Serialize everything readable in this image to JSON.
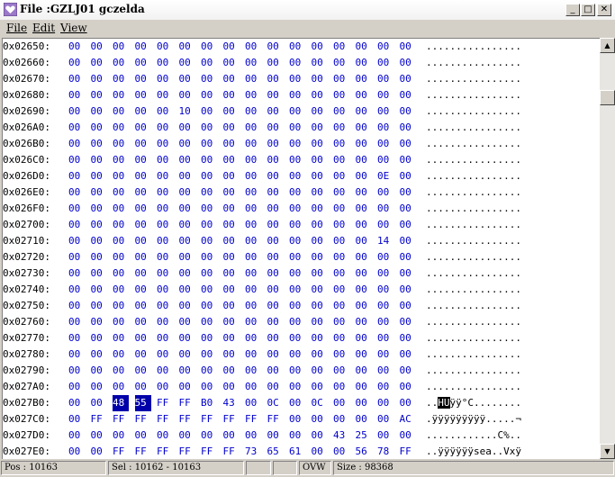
{
  "window": {
    "title": "File :GZLJ01 gczelda",
    "minimize_glyph": "_",
    "maximize_glyph": "□",
    "close_glyph": "✕"
  },
  "menu": {
    "file": "File",
    "edit": "Edit",
    "view": "View"
  },
  "hex_rows": [
    {
      "addr": "0x02650:",
      "bytes": [
        "00",
        "00",
        "00",
        "00",
        "00",
        "00",
        "00",
        "00",
        "00",
        "00",
        "00",
        "00",
        "00",
        "00",
        "00",
        "00"
      ],
      "ascii": "................"
    },
    {
      "addr": "0x02660:",
      "bytes": [
        "00",
        "00",
        "00",
        "00",
        "00",
        "00",
        "00",
        "00",
        "00",
        "00",
        "00",
        "00",
        "00",
        "00",
        "00",
        "00"
      ],
      "ascii": "................"
    },
    {
      "addr": "0x02670:",
      "bytes": [
        "00",
        "00",
        "00",
        "00",
        "00",
        "00",
        "00",
        "00",
        "00",
        "00",
        "00",
        "00",
        "00",
        "00",
        "00",
        "00"
      ],
      "ascii": "................"
    },
    {
      "addr": "0x02680:",
      "bytes": [
        "00",
        "00",
        "00",
        "00",
        "00",
        "00",
        "00",
        "00",
        "00",
        "00",
        "00",
        "00",
        "00",
        "00",
        "00",
        "00"
      ],
      "ascii": "................"
    },
    {
      "addr": "0x02690:",
      "bytes": [
        "00",
        "00",
        "00",
        "00",
        "00",
        "10",
        "00",
        "00",
        "00",
        "00",
        "00",
        "00",
        "00",
        "00",
        "00",
        "00"
      ],
      "ascii": "................"
    },
    {
      "addr": "0x026A0:",
      "bytes": [
        "00",
        "00",
        "00",
        "00",
        "00",
        "00",
        "00",
        "00",
        "00",
        "00",
        "00",
        "00",
        "00",
        "00",
        "00",
        "00"
      ],
      "ascii": "................"
    },
    {
      "addr": "0x026B0:",
      "bytes": [
        "00",
        "00",
        "00",
        "00",
        "00",
        "00",
        "00",
        "00",
        "00",
        "00",
        "00",
        "00",
        "00",
        "00",
        "00",
        "00"
      ],
      "ascii": "................"
    },
    {
      "addr": "0x026C0:",
      "bytes": [
        "00",
        "00",
        "00",
        "00",
        "00",
        "00",
        "00",
        "00",
        "00",
        "00",
        "00",
        "00",
        "00",
        "00",
        "00",
        "00"
      ],
      "ascii": "................"
    },
    {
      "addr": "0x026D0:",
      "bytes": [
        "00",
        "00",
        "00",
        "00",
        "00",
        "00",
        "00",
        "00",
        "00",
        "00",
        "00",
        "00",
        "00",
        "00",
        "0E",
        "00"
      ],
      "ascii": "................"
    },
    {
      "addr": "0x026E0:",
      "bytes": [
        "00",
        "00",
        "00",
        "00",
        "00",
        "00",
        "00",
        "00",
        "00",
        "00",
        "00",
        "00",
        "00",
        "00",
        "00",
        "00"
      ],
      "ascii": "................"
    },
    {
      "addr": "0x026F0:",
      "bytes": [
        "00",
        "00",
        "00",
        "00",
        "00",
        "00",
        "00",
        "00",
        "00",
        "00",
        "00",
        "00",
        "00",
        "00",
        "00",
        "00"
      ],
      "ascii": "................"
    },
    {
      "addr": "0x02700:",
      "bytes": [
        "00",
        "00",
        "00",
        "00",
        "00",
        "00",
        "00",
        "00",
        "00",
        "00",
        "00",
        "00",
        "00",
        "00",
        "00",
        "00"
      ],
      "ascii": "................"
    },
    {
      "addr": "0x02710:",
      "bytes": [
        "00",
        "00",
        "00",
        "00",
        "00",
        "00",
        "00",
        "00",
        "00",
        "00",
        "00",
        "00",
        "00",
        "00",
        "14",
        "00"
      ],
      "ascii": "................"
    },
    {
      "addr": "0x02720:",
      "bytes": [
        "00",
        "00",
        "00",
        "00",
        "00",
        "00",
        "00",
        "00",
        "00",
        "00",
        "00",
        "00",
        "00",
        "00",
        "00",
        "00"
      ],
      "ascii": "................"
    },
    {
      "addr": "0x02730:",
      "bytes": [
        "00",
        "00",
        "00",
        "00",
        "00",
        "00",
        "00",
        "00",
        "00",
        "00",
        "00",
        "00",
        "00",
        "00",
        "00",
        "00"
      ],
      "ascii": "................"
    },
    {
      "addr": "0x02740:",
      "bytes": [
        "00",
        "00",
        "00",
        "00",
        "00",
        "00",
        "00",
        "00",
        "00",
        "00",
        "00",
        "00",
        "00",
        "00",
        "00",
        "00"
      ],
      "ascii": "................"
    },
    {
      "addr": "0x02750:",
      "bytes": [
        "00",
        "00",
        "00",
        "00",
        "00",
        "00",
        "00",
        "00",
        "00",
        "00",
        "00",
        "00",
        "00",
        "00",
        "00",
        "00"
      ],
      "ascii": "................"
    },
    {
      "addr": "0x02760:",
      "bytes": [
        "00",
        "00",
        "00",
        "00",
        "00",
        "00",
        "00",
        "00",
        "00",
        "00",
        "00",
        "00",
        "00",
        "00",
        "00",
        "00"
      ],
      "ascii": "................"
    },
    {
      "addr": "0x02770:",
      "bytes": [
        "00",
        "00",
        "00",
        "00",
        "00",
        "00",
        "00",
        "00",
        "00",
        "00",
        "00",
        "00",
        "00",
        "00",
        "00",
        "00"
      ],
      "ascii": "................"
    },
    {
      "addr": "0x02780:",
      "bytes": [
        "00",
        "00",
        "00",
        "00",
        "00",
        "00",
        "00",
        "00",
        "00",
        "00",
        "00",
        "00",
        "00",
        "00",
        "00",
        "00"
      ],
      "ascii": "................"
    },
    {
      "addr": "0x02790:",
      "bytes": [
        "00",
        "00",
        "00",
        "00",
        "00",
        "00",
        "00",
        "00",
        "00",
        "00",
        "00",
        "00",
        "00",
        "00",
        "00",
        "00"
      ],
      "ascii": "................"
    },
    {
      "addr": "0x027A0:",
      "bytes": [
        "00",
        "00",
        "00",
        "00",
        "00",
        "00",
        "00",
        "00",
        "00",
        "00",
        "00",
        "00",
        "00",
        "00",
        "00",
        "00"
      ],
      "ascii": "................"
    },
    {
      "addr": "0x027B0:",
      "bytes": [
        "00",
        "00",
        "48",
        "55",
        "FF",
        "FF",
        "B0",
        "43",
        "00",
        "0C",
        "00",
        "0C",
        "00",
        "00",
        "00",
        "00"
      ],
      "ascii": "..HUÿÿ°C........"
    },
    {
      "addr": "0x027C0:",
      "bytes": [
        "00",
        "FF",
        "FF",
        "FF",
        "FF",
        "FF",
        "FF",
        "FF",
        "FF",
        "FF",
        "00",
        "00",
        "00",
        "00",
        "00",
        "AC"
      ],
      "ascii": ".ÿÿÿÿÿÿÿÿÿ.....¬"
    },
    {
      "addr": "0x027D0:",
      "bytes": [
        "00",
        "00",
        "00",
        "00",
        "00",
        "00",
        "00",
        "00",
        "00",
        "00",
        "00",
        "00",
        "43",
        "25",
        "00",
        "00"
      ],
      "ascii": "............C%.."
    },
    {
      "addr": "0x027E0:",
      "bytes": [
        "00",
        "00",
        "FF",
        "FF",
        "FF",
        "FF",
        "FF",
        "FF",
        "73",
        "65",
        "61",
        "00",
        "00",
        "56",
        "78",
        "FF"
      ],
      "ascii": "..ÿÿÿÿÿÿsea..Vxÿ"
    }
  ],
  "selection": {
    "row": 22,
    "hex_start": 2,
    "hex_end": 3,
    "ascii_text": "HU"
  },
  "status": {
    "pos": "Pos : 10163",
    "sel": "Sel : 10162 - 10163",
    "mode": "OVW",
    "size": "Size : 98368"
  },
  "colors": {
    "hex_text": "#0000cc",
    "selection_bg": "#0000aa"
  }
}
